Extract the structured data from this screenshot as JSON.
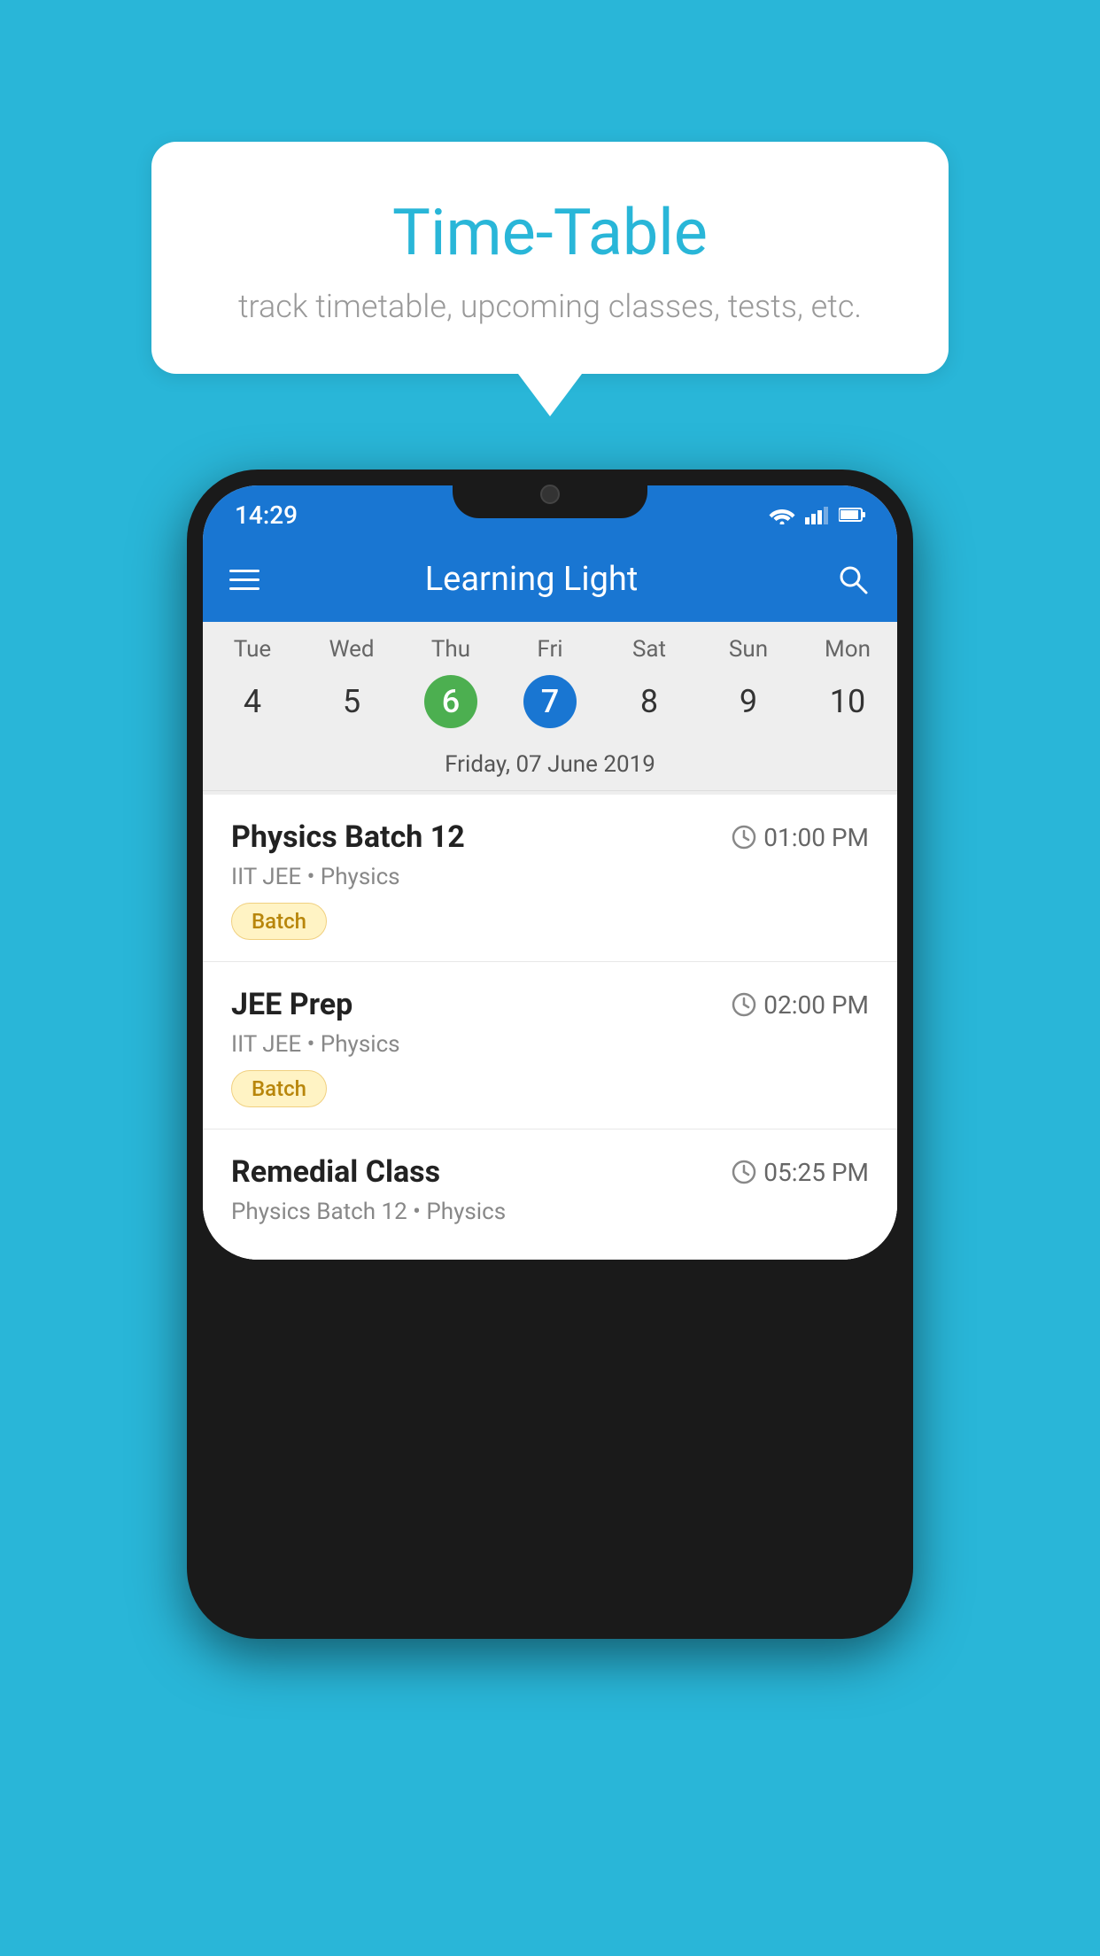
{
  "background_color": "#29B6D8",
  "speech_bubble": {
    "title": "Time-Table",
    "subtitle": "track timetable, upcoming classes, tests, etc."
  },
  "phone": {
    "status_bar": {
      "time": "14:29"
    },
    "app_bar": {
      "title": "Learning Light",
      "hamburger_label": "hamburger menu",
      "search_label": "search"
    },
    "calendar": {
      "day_headers": [
        "Tue",
        "Wed",
        "Thu",
        "Fri",
        "Sat",
        "Sun",
        "Mon"
      ],
      "day_numbers": [
        {
          "num": "4",
          "state": "normal"
        },
        {
          "num": "5",
          "state": "normal"
        },
        {
          "num": "6",
          "state": "today-green"
        },
        {
          "num": "7",
          "state": "selected-blue"
        },
        {
          "num": "8",
          "state": "normal"
        },
        {
          "num": "9",
          "state": "normal"
        },
        {
          "num": "10",
          "state": "normal"
        }
      ],
      "selected_date_label": "Friday, 07 June 2019"
    },
    "schedule_items": [
      {
        "name": "Physics Batch 12",
        "time": "01:00 PM",
        "sub": "IIT JEE • Physics",
        "tag": "Batch"
      },
      {
        "name": "JEE Prep",
        "time": "02:00 PM",
        "sub": "IIT JEE • Physics",
        "tag": "Batch"
      },
      {
        "name": "Remedial Class",
        "time": "05:25 PM",
        "sub": "Physics Batch 12 • Physics",
        "tag": null
      }
    ]
  }
}
